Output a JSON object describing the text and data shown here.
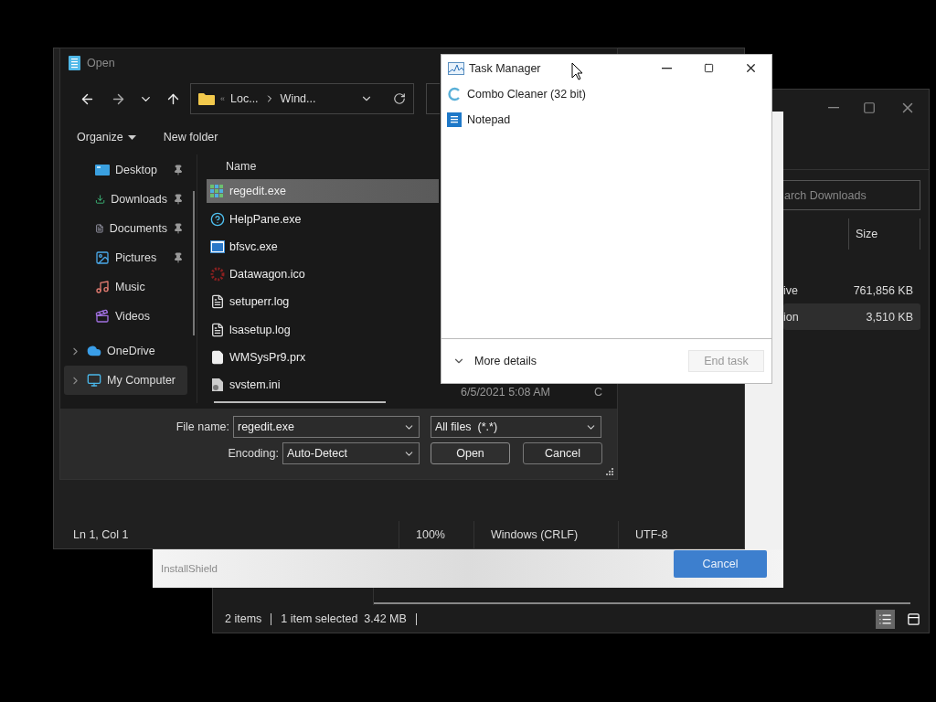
{
  "downloads_window": {
    "search": {
      "placeholder": "arch Downloads"
    },
    "columns": [
      {
        "label": "Size"
      }
    ],
    "rows": [
      {
        "name": "ive",
        "size": "761,856 KB",
        "selected": false
      },
      {
        "name": "ion",
        "size": "3,510 KB",
        "selected": true
      }
    ],
    "status_bar": [
      "2 items",
      "1 item selected  3.42 MB"
    ],
    "views": [
      {
        "kind": "details",
        "selected": true
      },
      {
        "kind": "preview",
        "selected": false
      }
    ]
  },
  "installshield_window": {
    "brand": "InstallShield",
    "buttons": [
      {
        "label": "Cancel"
      }
    ]
  },
  "notepad_window": {
    "status_bar": [
      "Ln 1, Col 1",
      "100%",
      "Windows (CRLF)",
      "UTF-8"
    ]
  },
  "open_dialog": {
    "title": "Open",
    "address": {
      "overflow": "«",
      "segments": [
        "Loc...",
        "Wind..."
      ]
    },
    "toolbar": [
      {
        "label": "Organize",
        "kind": "menu"
      },
      {
        "label": "New folder",
        "kind": "button"
      }
    ],
    "nav_pane": [
      {
        "label": "Desktop",
        "kind": "desktop",
        "pinned": true,
        "selected": false
      },
      {
        "label": "Downloads",
        "kind": "downloads",
        "pinned": true,
        "selected": false
      },
      {
        "label": "Documents",
        "kind": "documents",
        "pinned": true,
        "selected": false
      },
      {
        "label": "Pictures",
        "kind": "pictures",
        "pinned": true,
        "selected": false
      },
      {
        "label": "Music",
        "kind": "music",
        "pinned": false,
        "selected": false
      },
      {
        "label": "Videos",
        "kind": "videos",
        "pinned": false,
        "selected": false
      },
      {
        "label": "OneDrive",
        "kind": "cloud",
        "pinned": false,
        "selected": false,
        "expandable": true
      },
      {
        "label": "My Computer",
        "kind": "computer",
        "pinned": false,
        "selected": true,
        "expandable": true
      }
    ],
    "file_list": {
      "columns": [
        {
          "label": "Name"
        }
      ],
      "rows": [
        {
          "name": "regedit.exe",
          "kind": "registry",
          "selected": true
        },
        {
          "name": "HelpPane.exe",
          "kind": "help",
          "selected": false
        },
        {
          "name": "bfsvc.exe",
          "kind": "app",
          "selected": false
        },
        {
          "name": "Datawagon.ico",
          "kind": "ico",
          "selected": false
        },
        {
          "name": "setuperr.log",
          "kind": "text",
          "selected": false
        },
        {
          "name": "lsasetup.log",
          "kind": "text",
          "selected": false
        },
        {
          "name": "WMSysPr9.prx",
          "kind": "blank",
          "selected": false
        },
        {
          "name": "svstem.ini",
          "kind": "settings",
          "selected": false,
          "date": "6/5/2021 5:08 AM",
          "type": "C"
        }
      ]
    },
    "footer": {
      "file_name_label": "File name:",
      "file_name": "regedit.exe",
      "filter": "All files  (*.*)",
      "encoding_label": "Encoding:",
      "encoding": "Auto-Detect",
      "buttons": [
        {
          "label": "Open",
          "kind": "default"
        },
        {
          "label": "Cancel",
          "kind": "normal"
        }
      ]
    }
  },
  "task_manager": {
    "title": "Task Manager",
    "apps": [
      {
        "name": "Combo Cleaner (32 bit)",
        "kind": "cleaner"
      },
      {
        "name": "Notepad",
        "kind": "notepad"
      }
    ],
    "more_details": "More details",
    "end_task": {
      "label": "End task",
      "disabled": true
    }
  }
}
